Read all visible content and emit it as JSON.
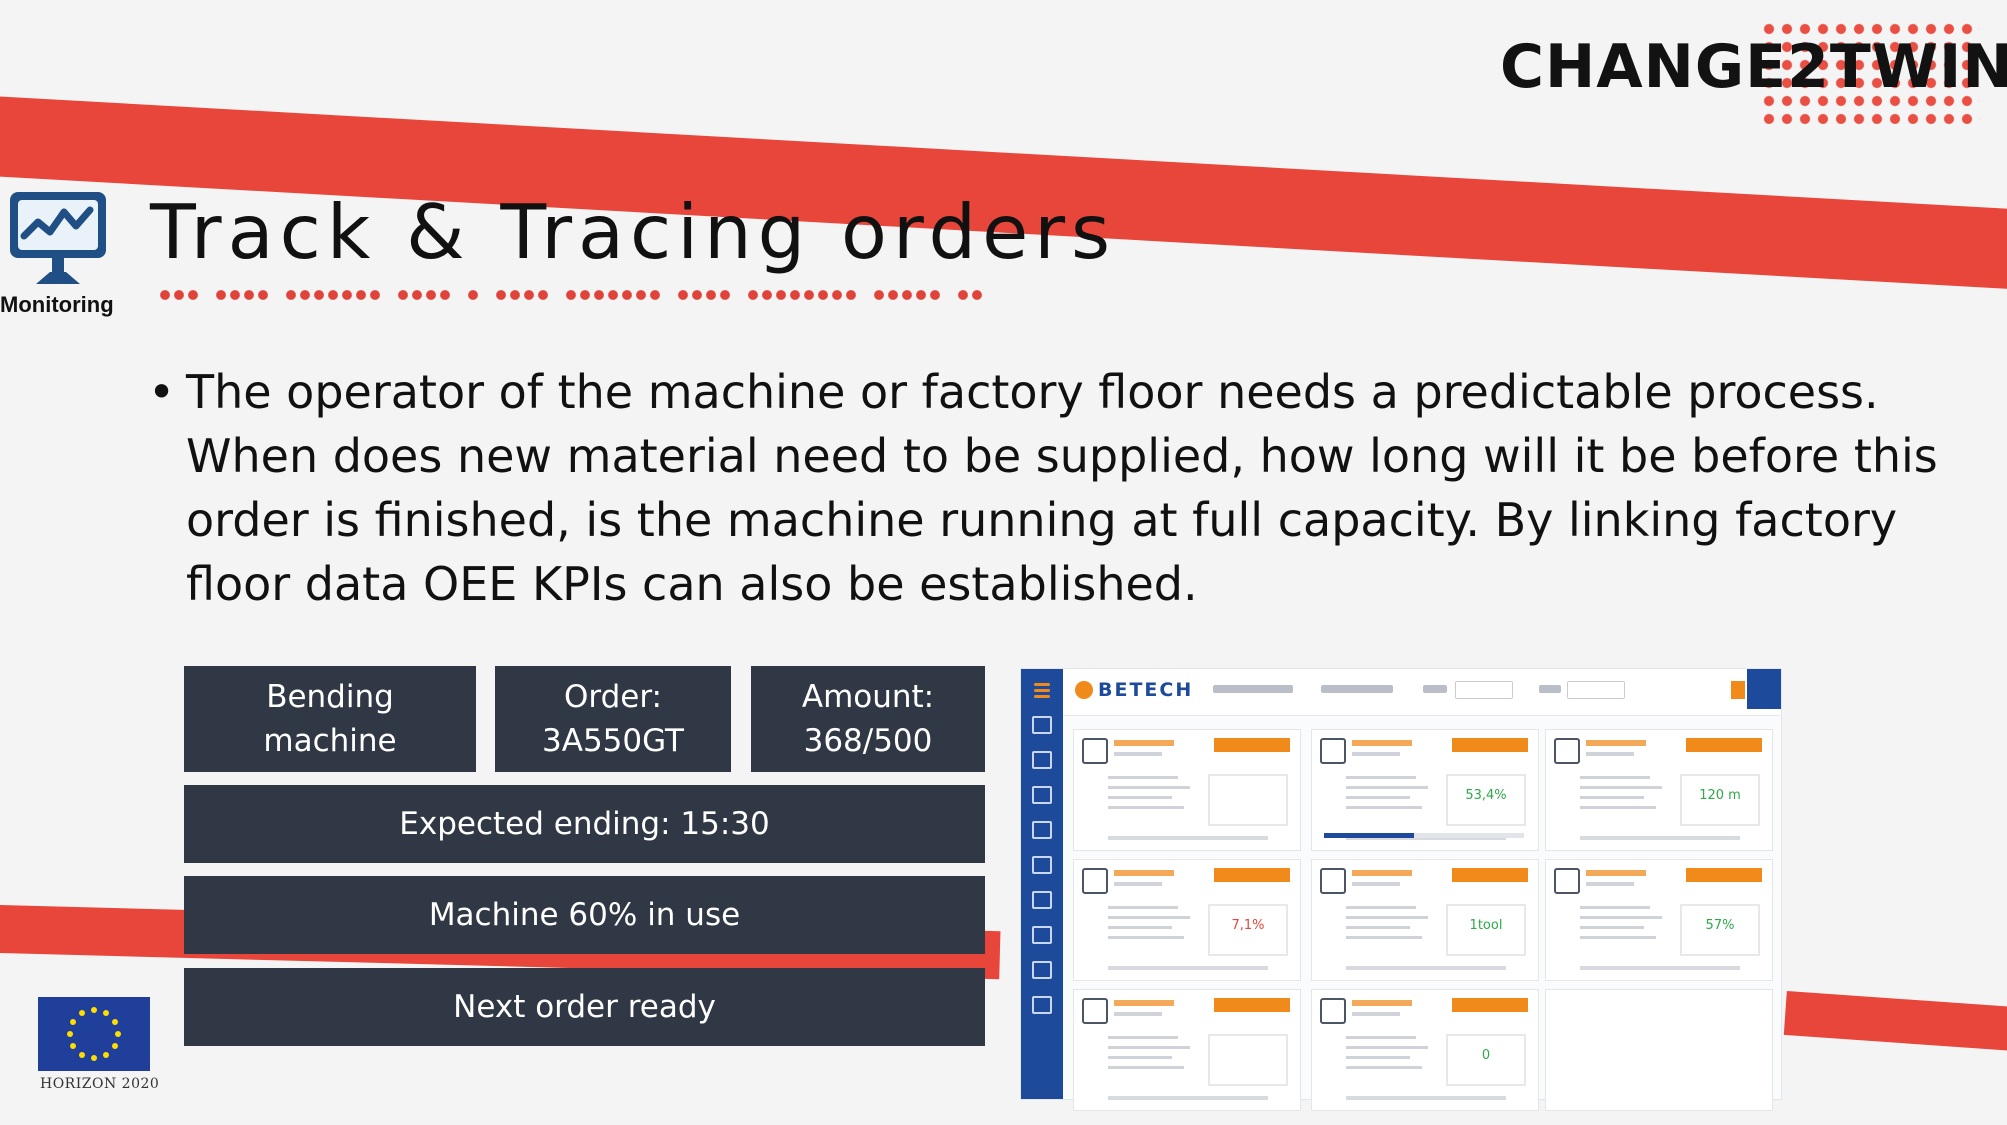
{
  "brand": {
    "logo_text": "CHANGE2TWIN",
    "accent_color": "#e8463a"
  },
  "monitoring": {
    "icon": "monitor-chart-icon",
    "label": "Monitoring"
  },
  "slide": {
    "title": "Track & Tracing orders",
    "bullet": "The operator of the machine or factory floor needs a predictable process. When does new material need to be supplied, how long will it be before this order is finished, is the machine running at full capacity. By linking factory floor data OEE KPIs can also be established."
  },
  "tiles": {
    "machine_line1": "Bending",
    "machine_line2": "machine",
    "order_line1": "Order:",
    "order_line2": "3A550GT",
    "amount_line1": "Amount:",
    "amount_line2": "368/500",
    "expected_ending": "Expected ending: 15:30",
    "machine_usage": "Machine 60% in use",
    "next_order": "Next order ready",
    "tile_color": "#2f3844"
  },
  "eu": {
    "flag_icon": "eu-flag-icon",
    "label": "HORIZON 2020"
  },
  "dashboard": {
    "brand": "BETECH",
    "cards": [
      {
        "icon": "document-icon",
        "value": ""
      },
      {
        "icon": "hourglass-icon",
        "value": "53,4%"
      },
      {
        "icon": "material-icon",
        "value": "120 m"
      },
      {
        "icon": "ruler-icon",
        "value": "7,1%"
      },
      {
        "icon": "tool-icon",
        "value": "1tool"
      },
      {
        "icon": "clipboard-icon",
        "value": "57%"
      },
      {
        "icon": "users-icon",
        "value": ""
      },
      {
        "icon": "bell-icon",
        "value": "0"
      }
    ]
  }
}
